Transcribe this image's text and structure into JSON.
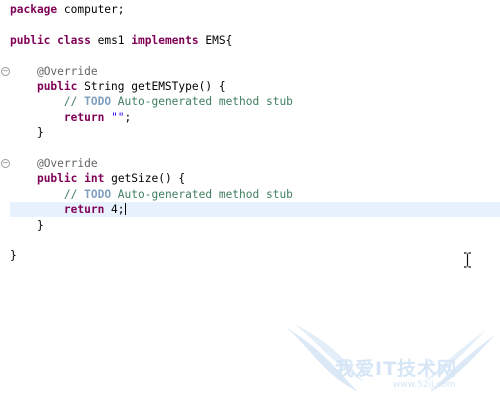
{
  "editor": {
    "lines": [
      {
        "parts": [
          {
            "t": "package",
            "c": "kw"
          },
          {
            "t": " computer;"
          }
        ]
      },
      {
        "parts": []
      },
      {
        "parts": [
          {
            "t": "public",
            "c": "kw"
          },
          {
            "t": " "
          },
          {
            "t": "class",
            "c": "kw"
          },
          {
            "t": " ems1 "
          },
          {
            "t": "implements",
            "c": "kw"
          },
          {
            "t": " EMS{"
          }
        ]
      },
      {
        "parts": []
      },
      {
        "fold": true,
        "parts": [
          {
            "t": "    "
          },
          {
            "t": "@Override",
            "c": "ann"
          }
        ]
      },
      {
        "parts": [
          {
            "t": "    "
          },
          {
            "t": "public",
            "c": "kw"
          },
          {
            "t": " String getEMSType() {"
          }
        ]
      },
      {
        "parts": [
          {
            "t": "        "
          },
          {
            "t": "// ",
            "c": "cmt"
          },
          {
            "t": "TODO",
            "c": "todo"
          },
          {
            "t": " Auto-generated method stub",
            "c": "cmt"
          }
        ]
      },
      {
        "parts": [
          {
            "t": "        "
          },
          {
            "t": "return",
            "c": "kw"
          },
          {
            "t": " "
          },
          {
            "t": "\"\"",
            "c": "str"
          },
          {
            "t": ";"
          }
        ]
      },
      {
        "parts": [
          {
            "t": "    }"
          }
        ]
      },
      {
        "parts": []
      },
      {
        "fold": true,
        "parts": [
          {
            "t": "    "
          },
          {
            "t": "@Override",
            "c": "ann"
          }
        ]
      },
      {
        "parts": [
          {
            "t": "    "
          },
          {
            "t": "public",
            "c": "kw"
          },
          {
            "t": " "
          },
          {
            "t": "int",
            "c": "kw"
          },
          {
            "t": " getSize() {"
          }
        ]
      },
      {
        "parts": [
          {
            "t": "        "
          },
          {
            "t": "// ",
            "c": "cmt"
          },
          {
            "t": "TODO",
            "c": "todo"
          },
          {
            "t": " Auto-generated method stub",
            "c": "cmt"
          }
        ]
      },
      {
        "current": true,
        "caret_after": 3,
        "parts": [
          {
            "t": "        "
          },
          {
            "t": "return",
            "c": "kw"
          },
          {
            "t": " 4"
          },
          {
            "t": ";"
          }
        ]
      },
      {
        "parts": [
          {
            "t": "    }"
          }
        ]
      },
      {
        "parts": []
      },
      {
        "parts": [
          {
            "t": "}"
          }
        ]
      }
    ]
  },
  "watermark": {
    "text": "我爱IT技术网",
    "url": "www.52ij.com"
  },
  "colors": {
    "keyword": "#7f0055",
    "annotation": "#646464",
    "comment": "#3f7f5f",
    "todo": "#7f9fbf",
    "string": "#2a00ff",
    "current_line": "#e8f2fe",
    "watermark": "#d6e6f6"
  },
  "icons": {
    "fold_marker": "minus-circle-icon",
    "mouse_cursor": "text-ibeam-icon",
    "watermark_logo": "wings-logo-icon"
  }
}
